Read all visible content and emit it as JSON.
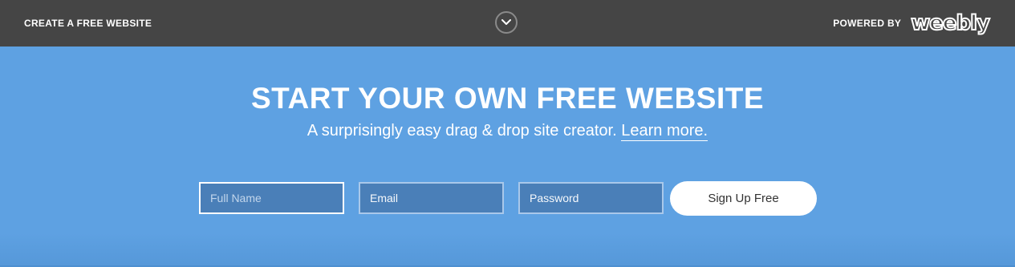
{
  "topbar": {
    "create_label": "CREATE A FREE WEBSITE",
    "toggle_icon": "chevron-down-icon",
    "powered_label": "POWERED BY",
    "brand": "weebly"
  },
  "hero": {
    "title": "START YOUR OWN FREE WEBSITE",
    "subtitle": "A surprisingly easy drag & drop site creator.",
    "learn_more": "Learn more.",
    "background_color": "#5ea1e2"
  },
  "form": {
    "full_name_placeholder": "Full Name",
    "email_placeholder": "Email",
    "password_placeholder": "Password",
    "submit_label": "Sign Up Free"
  }
}
